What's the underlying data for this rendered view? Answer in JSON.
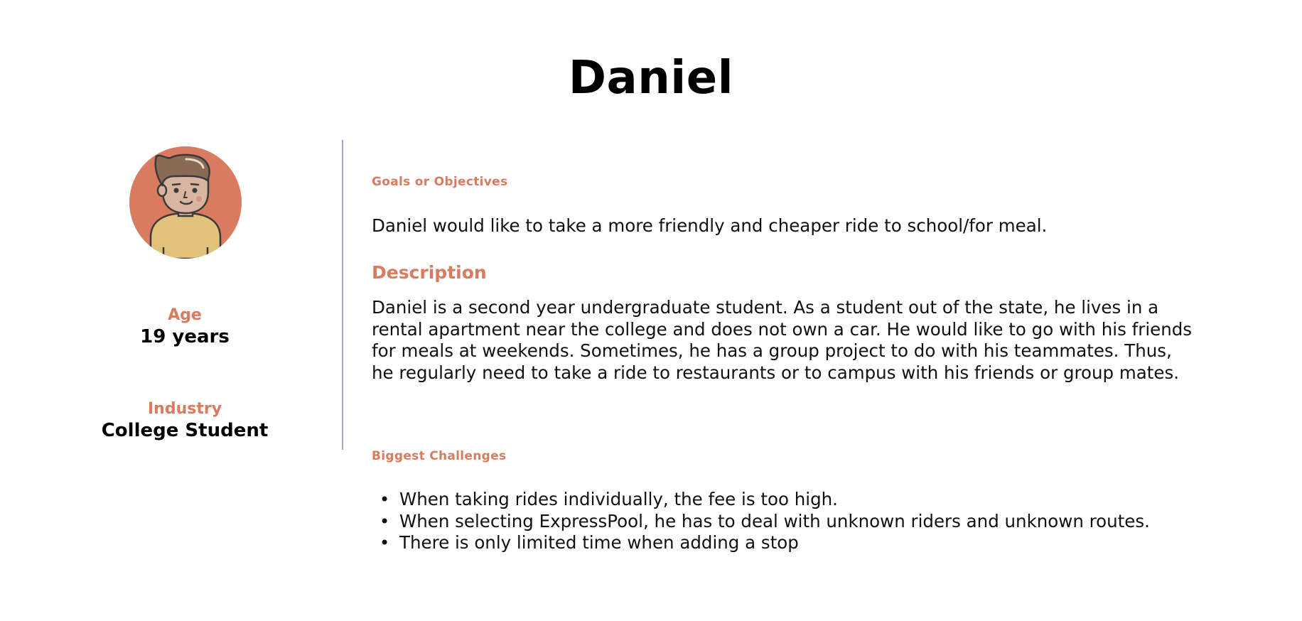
{
  "persona": {
    "name": "Daniel",
    "age_label": "Age",
    "age_value": "19 years",
    "industry_label": "Industry",
    "industry_value": "College Student",
    "avatar_icon": "male-student-avatar-icon"
  },
  "sections": {
    "goals_heading": "Goals or Objectives",
    "goals_text": "Daniel would like to take a more friendly and cheaper ride to school/for meal.",
    "description_heading": "Description",
    "description_text": "Daniel is a second year undergraduate student. As a student out of the state, he lives in a rental apartment near the college and does not own a car. He would like to go with his friends for meals at weekends. Sometimes, he has a group project to do with his teammates. Thus, he regularly need to take a ride to restaurants or to campus with his friends or group mates.",
    "challenges_heading": "Biggest Challenges",
    "challenges": [
      "When taking rides individually, the fee is too high.",
      "When selecting ExpressPool, he has to deal with unknown riders and unknown routes.",
      "There is only limited time when adding a stop"
    ]
  },
  "colors": {
    "accent": "#d97b5e",
    "divider": "#9daac6",
    "shirt": "#e2c27a",
    "hair": "#8a6a55",
    "skin": "#d9b5a0"
  }
}
